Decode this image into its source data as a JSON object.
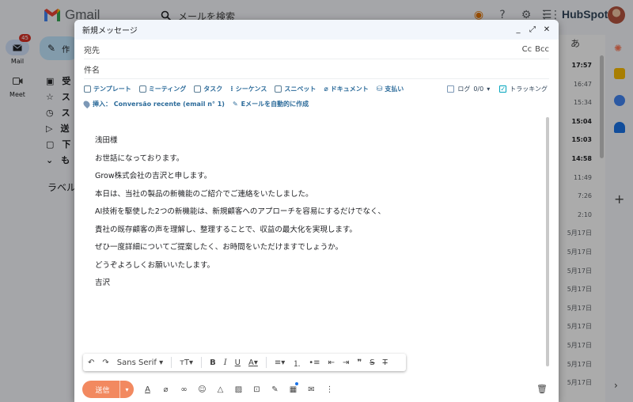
{
  "gmail": {
    "app_name": "Gmail",
    "search_placeholder": "メールを検索",
    "hubspot_logo": "HubSpot",
    "rail": [
      {
        "label": "Mail",
        "badge": "45"
      },
      {
        "label": "Meet"
      }
    ],
    "compose_label": "作",
    "nav": [
      "受",
      "ス",
      "ス",
      "送",
      "下",
      "も"
    ],
    "labels_heading": "ラベル",
    "language_indicator": "あ",
    "times": [
      {
        "text": "17:57",
        "bold": true
      },
      {
        "text": "16:47",
        "bold": false
      },
      {
        "text": "15:34",
        "bold": false
      },
      {
        "text": "15:04",
        "bold": true
      },
      {
        "text": "15:03",
        "bold": true
      },
      {
        "text": "14:58",
        "bold": true
      },
      {
        "text": "11:49",
        "bold": false
      },
      {
        "text": "7:26",
        "bold": false
      },
      {
        "text": "2:10",
        "bold": false
      },
      {
        "text": "5月17日",
        "bold": false
      },
      {
        "text": "5月17日",
        "bold": false
      },
      {
        "text": "5月17日",
        "bold": false
      },
      {
        "text": "5月17日",
        "bold": false
      },
      {
        "text": "5月17日",
        "bold": false
      },
      {
        "text": "5月17日",
        "bold": false
      },
      {
        "text": "5月17日",
        "bold": false
      },
      {
        "text": "5月17日",
        "bold": false
      },
      {
        "text": "5月17日",
        "bold": false
      }
    ]
  },
  "compose": {
    "title": "新規メッセージ",
    "to_label": "宛先",
    "cc_label": "Cc",
    "bcc_label": "Bcc",
    "subject_placeholder": "件名",
    "hubspot_tools": {
      "template": "テンプレート",
      "meeting": "ミーティング",
      "task": "タスク",
      "sequence": "シーケンス",
      "snippet": "スニペット",
      "document": "ドキュメント",
      "payment": "支払い",
      "log_label": "ログ",
      "log_count": "0/0",
      "tracking_label": "トラッキング",
      "insert_label": "挿入： Conversão recente (email n° 1)",
      "ai_write_label": "Eメールを自動的に作成"
    },
    "body_lines": [
      "浅田様",
      "お世話になっております。",
      "Grow株式会社の吉沢と申します。",
      "本日は、当社の製品の新機能のご紹介でご連絡をいたしました。",
      "AI技術を駆使した2つの新機能は、新規顧客へのアプローチを容易にするだけでなく、",
      "責社の既存顧客の声を理解し、整理することで、収益の最大化を実現します。",
      "ぜひ一度詳細についてご提案したく、お時間をいただけますでしょうか。",
      "どうぞよろしくお願いいたします。",
      "吉沢"
    ],
    "format_bar": {
      "undo": "↶",
      "redo": "↷",
      "font": "Sans Serif",
      "size": "тT",
      "bold": "B",
      "italic": "I",
      "underline": "U",
      "color": "A",
      "align": "≡",
      "quote": "❞",
      "strike": "S",
      "clear": "T"
    },
    "send_label": "送信"
  },
  "colors": {
    "send": "#f28960",
    "hubspot_link": "#2c6b9a",
    "tracking_check": "#00a4bd"
  }
}
